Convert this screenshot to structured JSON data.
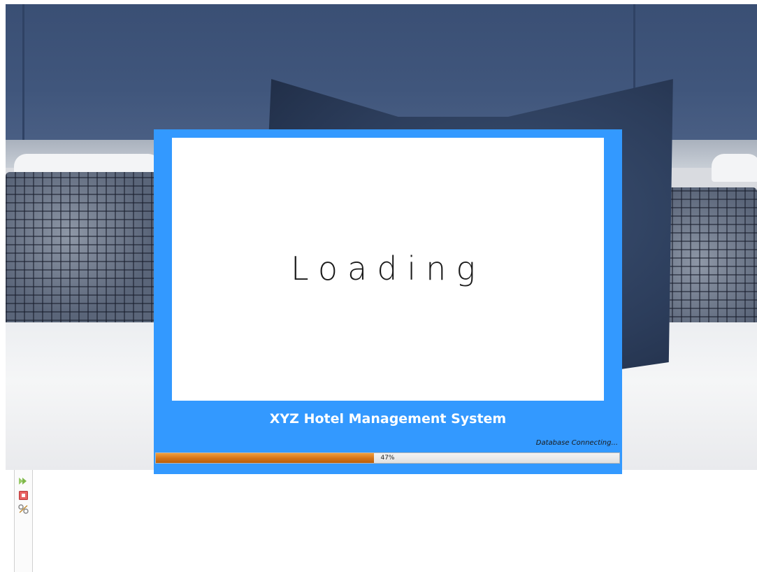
{
  "splash": {
    "loading_text": "Loading",
    "app_title": "XYZ Hotel Management System",
    "status_text": "Database Connecting...",
    "progress": {
      "value": 0.47,
      "label": "47%"
    }
  },
  "toolbar": {
    "icons": [
      "run-icon",
      "stop-icon",
      "tools-icon"
    ]
  },
  "colors": {
    "splash_border": "#3399ff",
    "progress_fill": "#d7761a",
    "headboard": "#40567c"
  }
}
